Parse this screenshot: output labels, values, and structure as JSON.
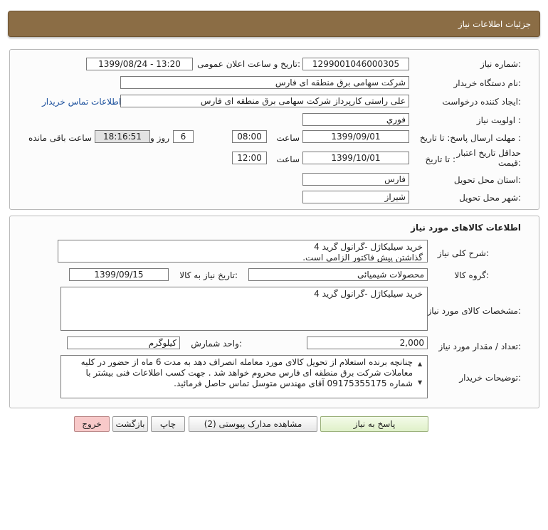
{
  "header": {
    "title": "جزئیات اطلاعات نیاز"
  },
  "info": {
    "need_number_label": "شماره نیاز:",
    "need_number": "1299001046000305",
    "announce_label": "تاریخ و ساعت اعلان عمومی:",
    "announce_value": "1399/08/24 - 13:20",
    "buyer_org_label": "نام دستگاه خریدار:",
    "buyer_org": "شرکت سهامی برق منطقه ای فارس",
    "requester_label": "ایجاد کننده درخواست:",
    "requester": "علی راستی کارپرداز شرکت سهامی برق منطقه ای فارس",
    "contact_link": "اطلاعات تماس خریدار",
    "priority_label": "اولویت نیاز :",
    "priority": "فوري",
    "deadline_label": "مهلت ارسال پاسخ: تا تاریخ :",
    "deadline_date": "1399/09/01",
    "time_label": "ساعت",
    "deadline_time": "08:00",
    "days_value": "6",
    "days_label": "روز و",
    "remaining_time": "18:16:51",
    "remaining_label": "ساعت باقی مانده",
    "validity_label_1": "حداقل تاریخ اعتبار",
    "validity_label_2": "قیمت:",
    "validity_to_label": "تا تاریخ :",
    "validity_date": "1399/10/01",
    "validity_time_label": "ساعت",
    "validity_time": "12:00",
    "province_label": "استان محل تحویل:",
    "province": "فارس",
    "city_label": "شهر محل تحویل:",
    "city": "شیراز"
  },
  "goods": {
    "section_title": "اطلاعات کالاهای مورد نیاز",
    "desc_label": "شرح کلی نیاز:",
    "desc_line1": "خرید سیلیکاژل -گرانول گرید 4",
    "desc_line2": "گذاشتن پیش فاکتور الزامی است.",
    "group_label": "گروه کالا:",
    "group": "محصولات شیمیائی",
    "need_date_label": "تاریخ نیاز به کالا:",
    "need_date": "1399/09/15",
    "spec_label": "مشخصات کالای مورد نیاز:",
    "spec": "خرید سیلیکاژل -گرانول گرید 4",
    "qty_label": "تعداد / مقدار مورد نیاز:",
    "qty": "2,000",
    "unit_label": "واحد شمارش:",
    "unit": "کیلوگرم",
    "notes_label": "توضیحات خریدار:",
    "notes": "چنانچه برنده استعلام از تحویل کالای مورد معامله انصراف دهد به مدت 6 ماه از حضور در کلیه معاملات شرکت برق منطقه ای فارس محروم خواهد شد . جهت کسب اطلاعات فنی بیشتر با شماره  09175355175 آقای مهندس متوسل تماس حاصل فرمائید."
  },
  "buttons": {
    "reply": "پاسخ به نیاز",
    "attachments": "مشاهده مدارک پیوستی (2)",
    "print": "چاپ",
    "back": "بازگشت",
    "exit": "خروج"
  },
  "colors": {
    "header_bg": "#8b6d45",
    "exit_bg": "#f8c9c9",
    "reply_bg": "#dff0c9"
  }
}
